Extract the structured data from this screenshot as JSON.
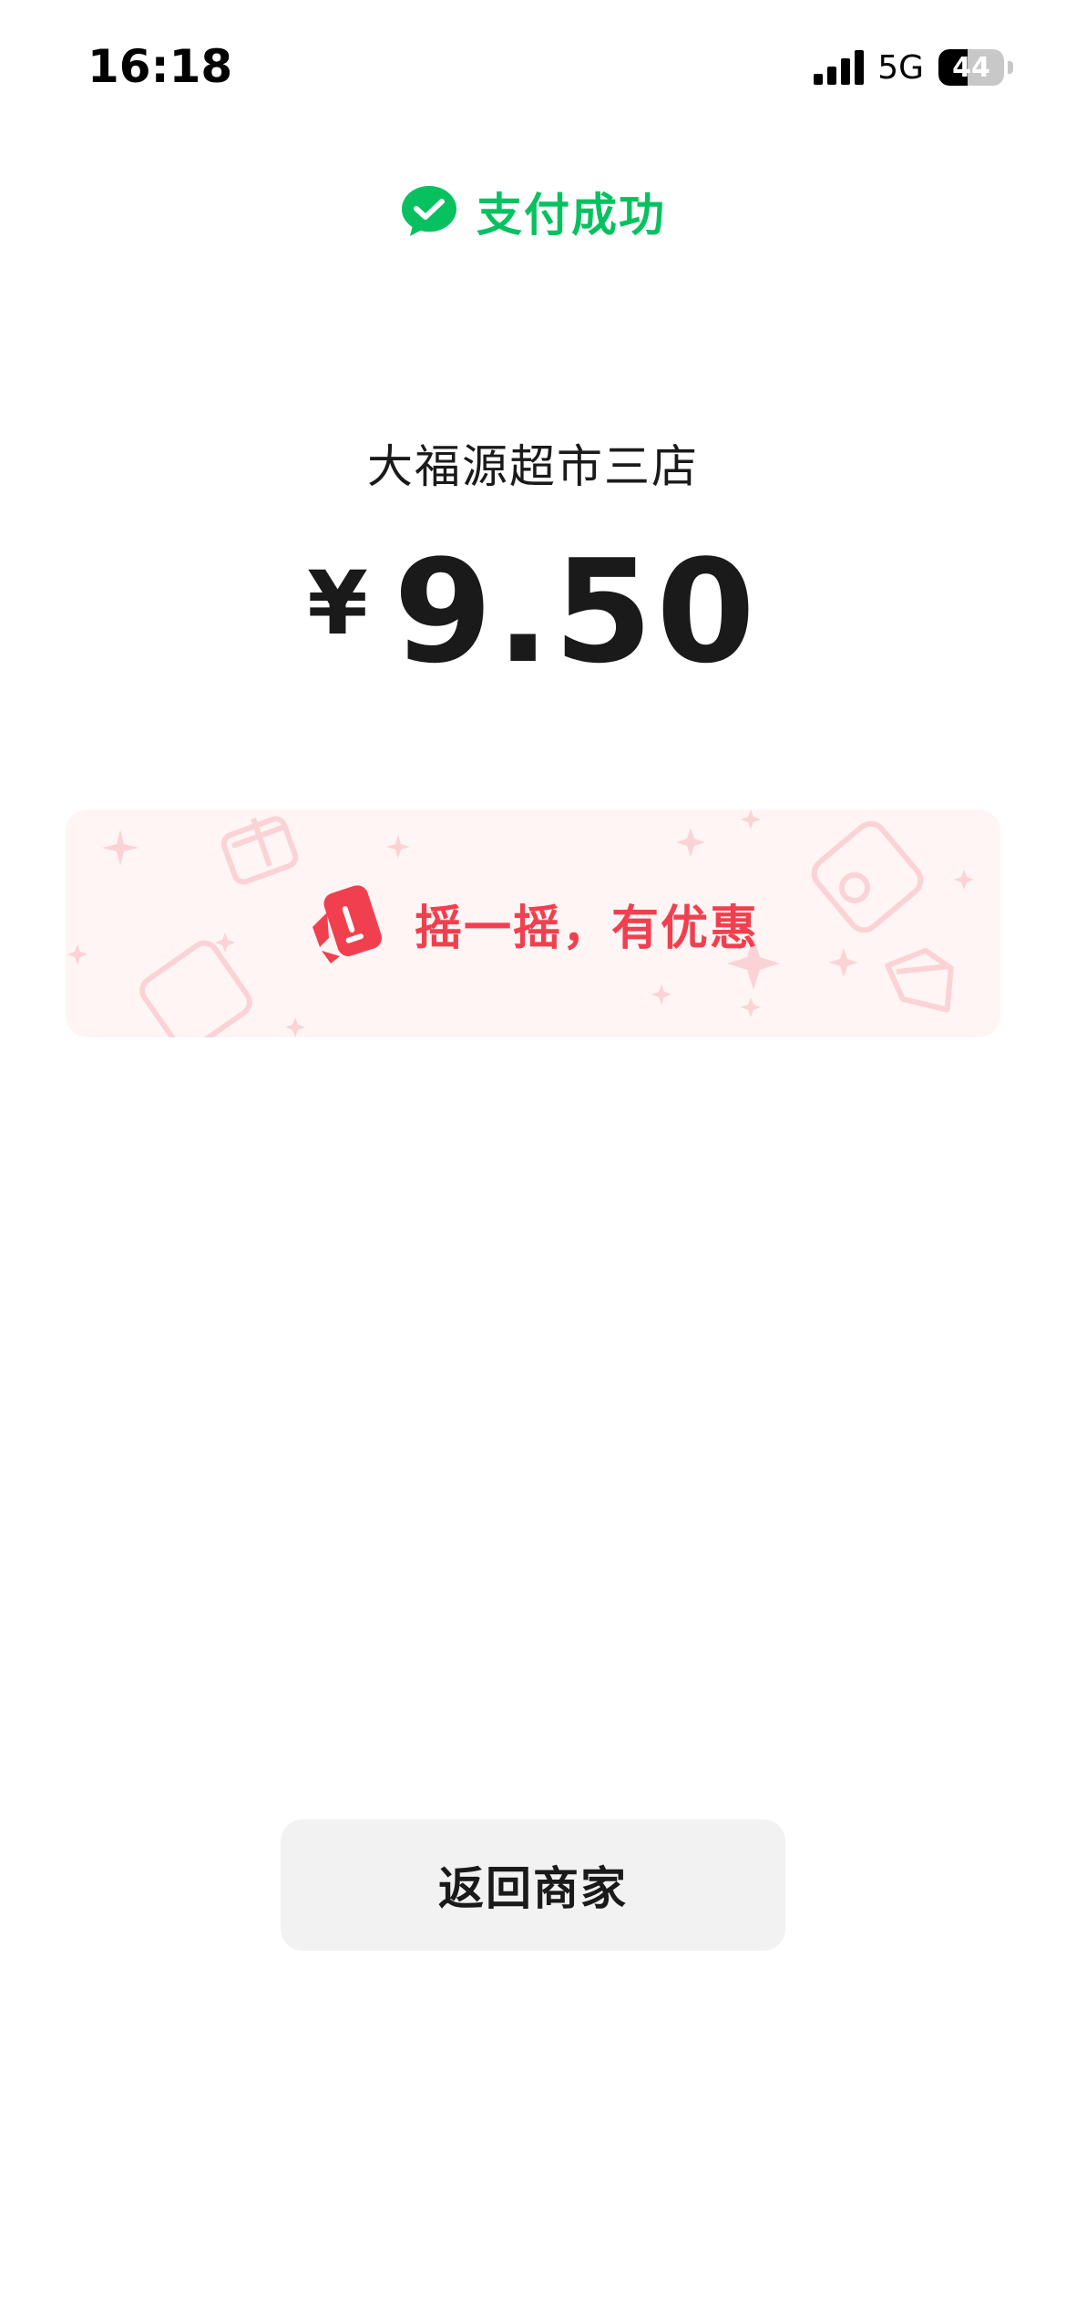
{
  "status_bar": {
    "time": "16:18",
    "network": "5G",
    "battery_level": "44",
    "battery_fraction": 0.44,
    "signal_bars": 4
  },
  "header": {
    "title": "支付成功",
    "icon": "wechat-pay-icon"
  },
  "payment": {
    "merchant": "大福源超市三店",
    "currency_symbol": "¥",
    "amount": "9.50"
  },
  "promo_banner": {
    "text": "摇一摇，有优惠",
    "icon": "shake-phone-icon"
  },
  "actions": {
    "return_label": "返回商家"
  },
  "colors": {
    "brand_green": "#07c160",
    "promo_red": "#f0404f",
    "promo_bg": "#fff5f5",
    "button_bg": "#f2f2f2"
  }
}
